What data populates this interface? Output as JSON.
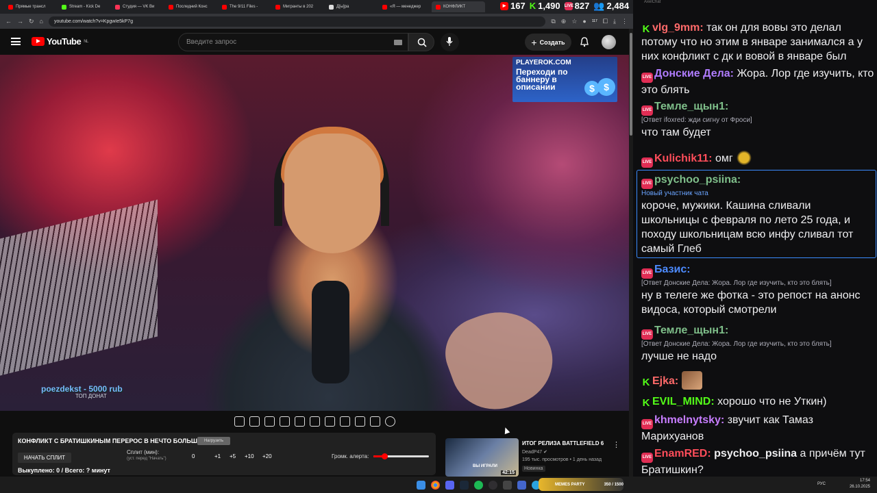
{
  "browser": {
    "tabs": [
      {
        "label": "Прямые трансл",
        "color": "#ff0000"
      },
      {
        "label": "Stream - Kick De",
        "color": "#53fc18"
      },
      {
        "label": "Студия — VK Ви",
        "color": "#ff3355"
      },
      {
        "label": "Последний Конс",
        "color": "#ff0000"
      },
      {
        "label": "The 9/11 Files -",
        "color": "#ff0000"
      },
      {
        "label": "Мигранты в 202",
        "color": "#ff0000"
      },
      {
        "label": "Д[ы]ра",
        "color": "#dddddd"
      },
      {
        "label": "«Я — менеджер",
        "color": "#ff0000"
      },
      {
        "label": "КОНФЛИКТ",
        "color": "#ff0000"
      }
    ],
    "url": "youtube.com/watch?v=KpgwIe5kP7g",
    "badge_count": "117"
  },
  "stream_stats": {
    "youtube_viewers": "167",
    "kick_viewers": "1,490",
    "live_viewers": "827",
    "total_viewers": "2,484"
  },
  "youtube": {
    "logo_text": "YouTube",
    "region": "NL",
    "search_placeholder": "Введите запрос",
    "create_label": "Создать"
  },
  "video": {
    "ad_brand": "PLAYEROK.COM",
    "ad_text": "Переходи по баннеру в описании",
    "ticker_name": "poezdekst - 5000 rub",
    "ticker_sub": "ТОП ДОНАТ"
  },
  "panel": {
    "title": "КОНФЛИКТ С БРАТИШКИНЫМ ПЕРЕРОС В НЕЧТО БОЛЬШЕЕ...",
    "pill": "Нагрузить",
    "split_button": "НАЧАТЬ СПЛИТ",
    "split_label": "Сплит (мин):",
    "split_hint": "(уст. перед \"Начать\")",
    "split_values": [
      "0",
      "+1",
      "+5",
      "+10",
      "+20"
    ],
    "volume_label": "Громк. алерта:",
    "volume_level": 0.2,
    "bottom": "Выкуплено: 0 / Всего: ? минут"
  },
  "recommendation": {
    "title": "ИТОГ РЕЛИЗА BATTLEFIELD 6",
    "channel": "DeadP47",
    "meta": "195 тыс. просмотров • 1 день назад",
    "badge": "Новинка",
    "duration": "42:15",
    "thumb_text": "ВЫ ИГРАЛИ"
  },
  "chat": {
    "window_title": "AxelChat",
    "messages": [
      {
        "platform": "k",
        "user": "vlg_9mm:",
        "user_color": "#ff6a6a",
        "text": "так он для вовы это делал потому что но этим в январе занимался а у них конфликт с дк и вовой в январе был"
      },
      {
        "platform": "yt",
        "user": "Донские Дела:",
        "user_color": "#b07cff",
        "text": "Жора. Лор где изучить, кто это блять"
      },
      {
        "platform": "yt",
        "user": "Темле_щын1:",
        "user_color": "#7fbf8a",
        "reply": "[Ответ ifoxred: жди сигну от Фроси]",
        "text": "что там будет"
      },
      {
        "platform": "yt",
        "user": "Kulichik11:",
        "user_color": "#ff4d5a",
        "text": "омг"
      },
      {
        "platform": "yt",
        "user": "psychoo_psiina:",
        "user_color": "#7fbf8a",
        "new_member": "Новый участник чата",
        "text": "короче, мужики. Кашина сливали школьницы с февраля по лето 25 года, и походу школьницам всю инфу сливал тот самый Глеб"
      },
      {
        "platform": "yt",
        "user": "Базис:",
        "user_color": "#4d8bff",
        "reply": "[Ответ Донские Дела: Жора. Лор где изучить, кто это блять]",
        "text": "ну в телеге же фотка - это репост на анонс видоса, который смотрели"
      },
      {
        "platform": "yt",
        "user": "Темле_щын1:",
        "user_color": "#7fbf8a",
        "reply": "[Ответ Донские Дела: Жора. Лор где изучить, кто это блять]",
        "text": "лучше не надо"
      },
      {
        "platform": "k",
        "user": "Ejka:",
        "user_color": "#ff6a6a",
        "text": ""
      },
      {
        "platform": "k",
        "user": "EVIL_MIND:",
        "user_color": "#53fc18",
        "text": "хорошо что не Уткин)"
      },
      {
        "platform": "yt",
        "user": "khmelnytsky:",
        "user_color": "#c77dff",
        "text": "звучит как Тамаз Марихуанов"
      },
      {
        "platform": "yt",
        "user": "EnamRED:",
        "user_color": "#ff4d5a",
        "mention": "psychoo_psiina",
        "text": "а причём тут Братишкин?"
      }
    ]
  },
  "taskbar": {
    "memes": "MEMES PARTY",
    "memes_count": "350 / 1500",
    "lang": "РУС",
    "time": "17:54",
    "date": "26.10.2025"
  }
}
